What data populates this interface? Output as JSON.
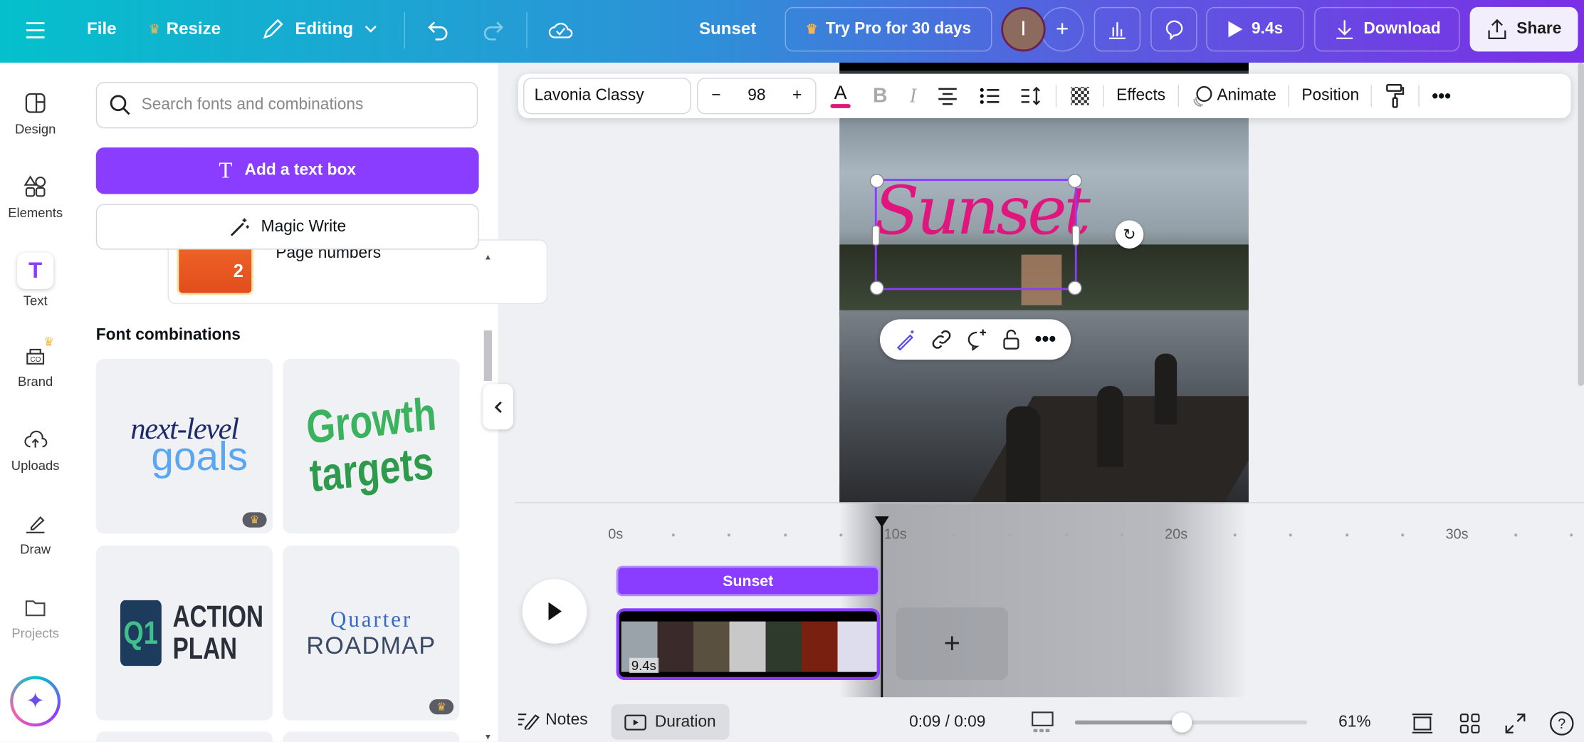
{
  "topbar": {
    "file": "File",
    "resize": "Resize",
    "editing": "Editing",
    "title": "Sunset",
    "try_pro": "Try Pro for 30 days",
    "avatar_initial": "I",
    "play_duration": "9.4s",
    "download": "Download",
    "share": "Share"
  },
  "rail": [
    {
      "label": "Design"
    },
    {
      "label": "Elements"
    },
    {
      "label": "Text"
    },
    {
      "label": "Brand"
    },
    {
      "label": "Uploads"
    },
    {
      "label": "Draw"
    },
    {
      "label": "Projects"
    }
  ],
  "panel": {
    "search_placeholder": "Search fonts and combinations",
    "add_text_box": "Add a text box",
    "magic_write": "Magic Write",
    "page_numbers": "Page numbers",
    "page_number_sample": "2",
    "font_combinations": "Font combinations",
    "cards": [
      {
        "line1": "next-level",
        "line2": "goals",
        "pro": true
      },
      {
        "line1": "Growth",
        "line2": "targets",
        "pro": false
      },
      {
        "line1": "Q1",
        "line2": "ACTION PLAN",
        "pro": false
      },
      {
        "line1": "Quarter",
        "line2": "ROADMAP",
        "pro": true
      }
    ]
  },
  "format_toolbar": {
    "font": "Lavonia Classy",
    "size": "98",
    "effects": "Effects",
    "animate": "Animate",
    "position": "Position",
    "text_color": "#e0157d"
  },
  "canvas": {
    "text": "Sunset"
  },
  "timeline": {
    "ruler": [
      "0s",
      "10s",
      "20s",
      "30s"
    ],
    "text_track": "Sunset",
    "clip_duration": "9.4s"
  },
  "bottombar": {
    "notes": "Notes",
    "duration": "Duration",
    "time": "0:09 / 0:09",
    "zoom": "61%",
    "zoom_value": 61
  },
  "colors": {
    "accent": "#8b3dff"
  }
}
